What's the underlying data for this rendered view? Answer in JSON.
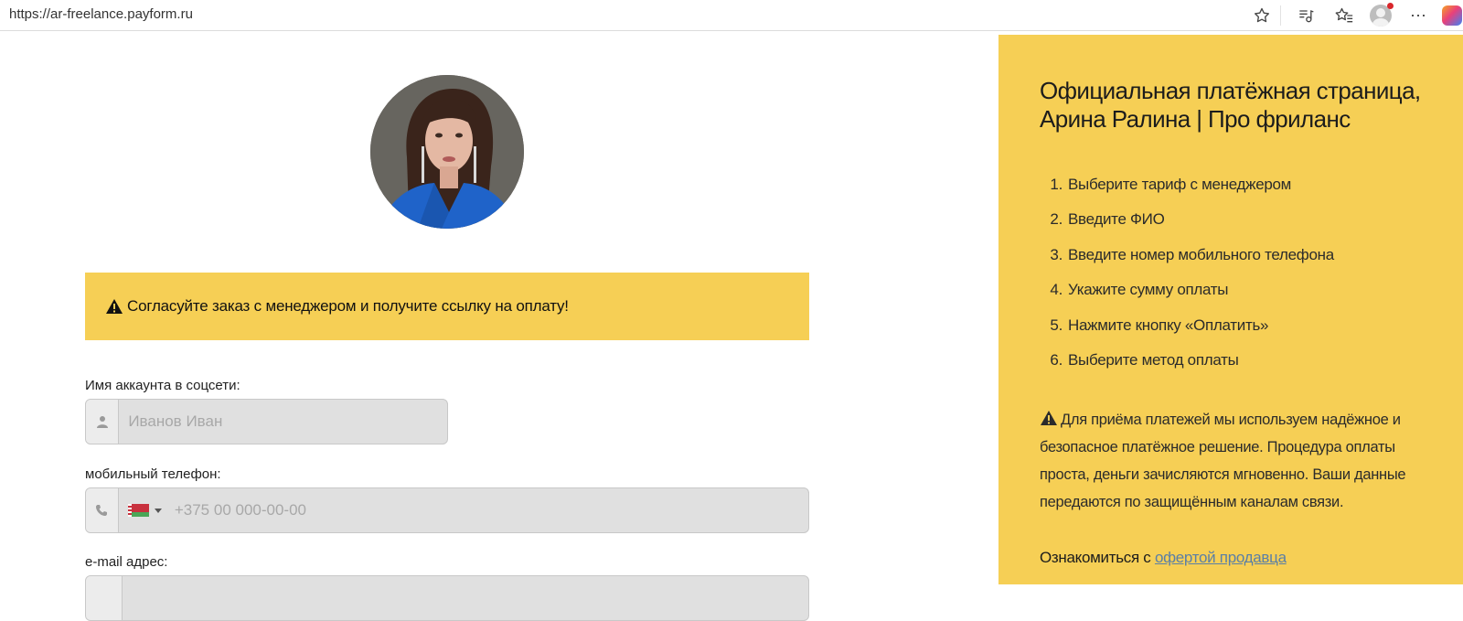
{
  "browser": {
    "url": "https://ar-freelance.payform.ru"
  },
  "notice": {
    "text": "Согласуйте заказ с менеджером и получите ссылку на оплату!"
  },
  "form": {
    "name_label": "Имя аккаунта в соцсети:",
    "name_placeholder": "Иванов Иван",
    "phone_label": "мобильный телефон:",
    "phone_placeholder": "+375 00 000-00-00",
    "email_label": "e-mail адрес:"
  },
  "sidebar": {
    "title": "Официальная платёжная страница, Арина Ралина | Про фриланс",
    "steps": [
      {
        "num": "1.",
        "text": "Выберите тариф с менеджером"
      },
      {
        "num": "2.",
        "text": "Введите ФИО"
      },
      {
        "num": "3.",
        "text": "Введите номер мобильного телефона"
      },
      {
        "num": "4.",
        "text": "Укажите сумму оплаты"
      },
      {
        "num": "5.",
        "text": "Нажмите кнопку «Оплатить»"
      },
      {
        "num": "6.",
        "text": "Выберите метод оплаты"
      }
    ],
    "security_text": "Для приёма платежей мы используем надёжное и безопасное платёжное решение. Процедура оплаты проста, деньги зачисляются мгновенно. Ваши данные передаются по защищённым каналам связи.",
    "offer_prefix": "Ознакомиться с",
    "offer_link": "офертой продавца"
  },
  "colors": {
    "accent_yellow": "#f6cf55",
    "link": "#5a7fa6"
  },
  "icons": [
    "star-icon",
    "media-icon",
    "favorites-icon",
    "profile-icon",
    "more-icon",
    "copilot-icon",
    "warning-icon",
    "user-icon",
    "phone-icon",
    "flag-belarus-icon"
  ]
}
